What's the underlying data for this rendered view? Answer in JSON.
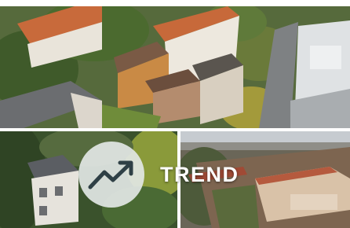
{
  "banner": {
    "label": "TREND",
    "icon": "trending-up-icon"
  },
  "colors": {
    "badge_background": "#e2e7e5",
    "icon_stroke": "#2f4046",
    "label": "#ffffff"
  }
}
